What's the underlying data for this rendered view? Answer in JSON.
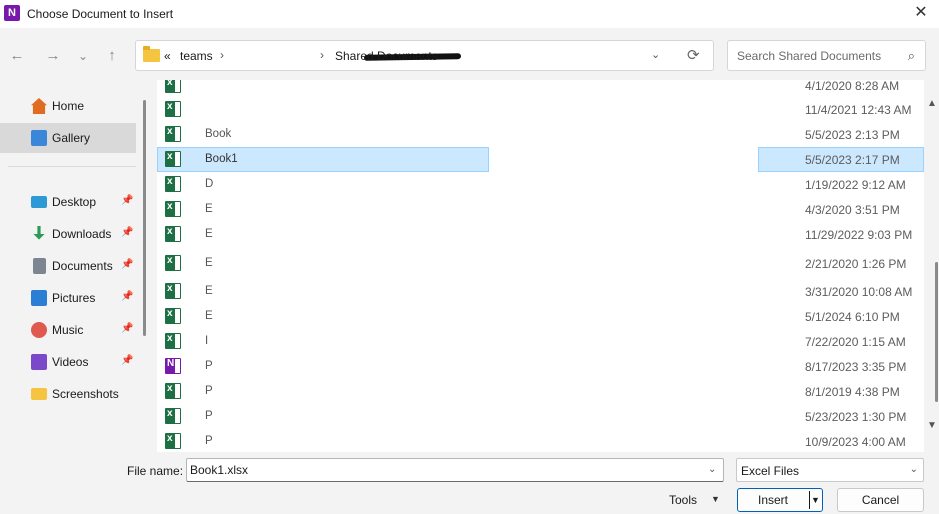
{
  "window": {
    "title": "Choose Document to Insert",
    "app_icon": "onenote-icon",
    "close_glyph": "✕"
  },
  "nav": {
    "back": "←",
    "forward": "→",
    "recent": "⌄",
    "up": "↑"
  },
  "address": {
    "prefix": "«",
    "crumbs": [
      "teams",
      "Shared Documents"
    ],
    "sep": "›",
    "refresh": "⟳",
    "chevron": "⌄"
  },
  "search": {
    "placeholder": "Search Shared Documents",
    "icon": "⌕"
  },
  "sidebar": {
    "items": [
      {
        "label": "Home",
        "icon": "home-icon",
        "color": "#e06c1f",
        "pinned": false,
        "selected": false
      },
      {
        "label": "Gallery",
        "icon": "gallery-icon",
        "color": "#3a86d8",
        "pinned": false,
        "selected": true
      },
      {
        "label": "Desktop",
        "icon": "desktop-icon",
        "color": "#2d9ad6",
        "pinned": true,
        "selected": false
      },
      {
        "label": "Downloads",
        "icon": "downloads-icon",
        "color": "#2a9c57",
        "pinned": true,
        "selected": false
      },
      {
        "label": "Documents",
        "icon": "documents-icon",
        "color": "#7d8590",
        "pinned": true,
        "selected": false
      },
      {
        "label": "Pictures",
        "icon": "pictures-icon",
        "color": "#2a7fd4",
        "pinned": true,
        "selected": false
      },
      {
        "label": "Music",
        "icon": "music-icon",
        "color": "#e0594e",
        "pinned": true,
        "selected": false
      },
      {
        "label": "Videos",
        "icon": "videos-icon",
        "color": "#7a48c9",
        "pinned": true,
        "selected": false
      },
      {
        "label": "Screenshots",
        "icon": "folder-icon",
        "color": "#f5c542",
        "pinned": false,
        "selected": false
      }
    ],
    "pin_glyph": "📌"
  },
  "files": [
    {
      "name": "",
      "date": "4/1/2020 8:28 AM",
      "type": "excel",
      "selected": false
    },
    {
      "name": "",
      "date": "11/4/2021 12:43 AM",
      "type": "excel",
      "selected": false
    },
    {
      "name": "Book",
      "date": "5/5/2023 2:13 PM",
      "type": "excel",
      "selected": false
    },
    {
      "name": "Book1",
      "date": "5/5/2023 2:17 PM",
      "type": "excel",
      "selected": true
    },
    {
      "name": "D",
      "date": "1/19/2022 9:12 AM",
      "type": "excel",
      "selected": false
    },
    {
      "name": "E",
      "date": "4/3/2020 3:51 PM",
      "type": "excel",
      "selected": false
    },
    {
      "name": "E",
      "date": "11/29/2022 9:03 PM",
      "type": "excel",
      "selected": false
    },
    {
      "name": "E",
      "date": "2/21/2020 1:26 PM",
      "type": "excel",
      "selected": false
    },
    {
      "name": "E",
      "date": "3/31/2020 10:08 AM",
      "type": "excel",
      "selected": false
    },
    {
      "name": "E",
      "date": "5/1/2024 6:10 PM",
      "type": "excel",
      "selected": false
    },
    {
      "name": "I",
      "date": "7/22/2020 1:15 AM",
      "type": "excel",
      "selected": false
    },
    {
      "name": "P",
      "date": "8/17/2023 3:35 PM",
      "type": "onenote",
      "selected": false
    },
    {
      "name": "P",
      "date": "8/1/2019 4:38 PM",
      "type": "excel",
      "selected": false
    },
    {
      "name": "P",
      "date": "5/23/2023 1:30 PM",
      "type": "excel",
      "selected": false
    },
    {
      "name": "P",
      "date": "10/9/2023 4:00 AM",
      "type": "excel",
      "selected": false
    }
  ],
  "scroll": {
    "up": "▲",
    "down": "▼"
  },
  "footer": {
    "file_name_label": "File name:",
    "file_name_value": "Book1.xlsx",
    "file_type": "Excel Files",
    "tools_label": "Tools",
    "insert_label": "Insert",
    "cancel_label": "Cancel",
    "caret": "▼",
    "chevron": "⌄"
  },
  "colors": {
    "selection": "#cce8ff",
    "selection_border": "#99d1ff",
    "excel": "#1d7044",
    "onenote": "#7719aa",
    "accent": "#005fb8"
  }
}
